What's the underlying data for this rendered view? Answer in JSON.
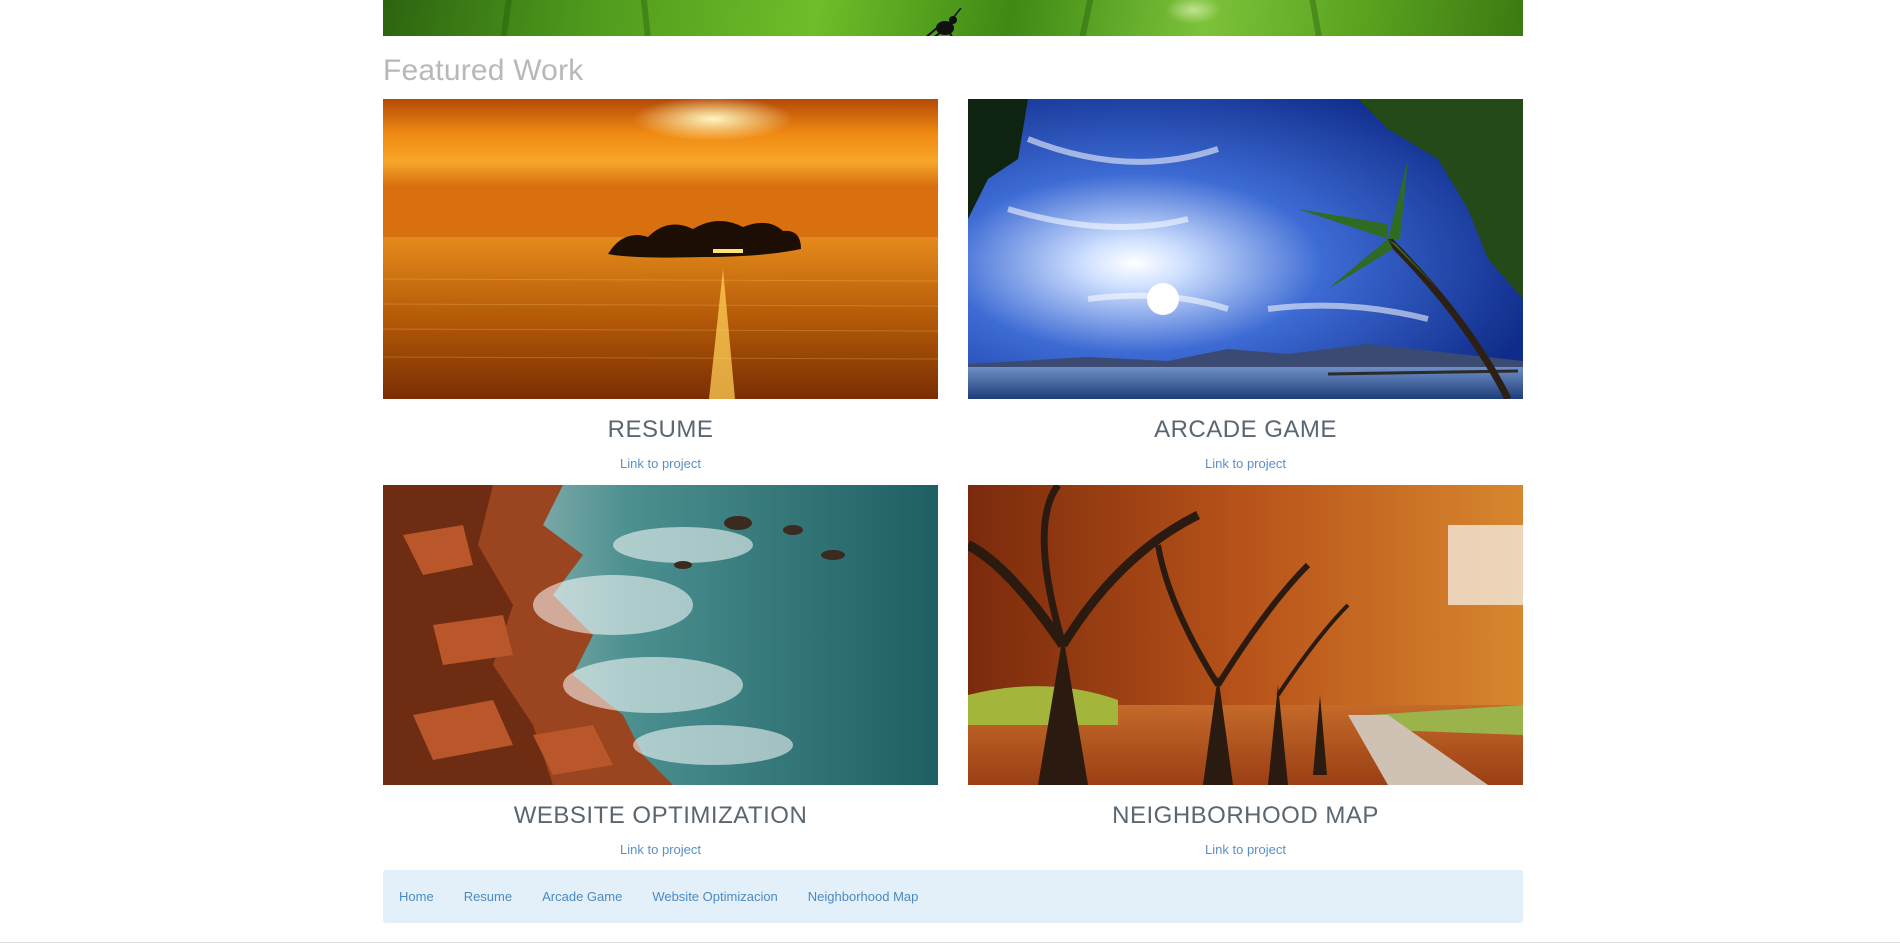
{
  "section": {
    "title": "Featured Work"
  },
  "projects": [
    {
      "name": "RESUME",
      "link_label": "Link to project",
      "image": "sunset-island-photo"
    },
    {
      "name": "ARCADE GAME",
      "link_label": "Link to project",
      "image": "palm-beach-sky-photo"
    },
    {
      "name": "WEBSITE OPTIMIZATION",
      "link_label": "Link to project",
      "image": "rocky-coast-sea-photo"
    },
    {
      "name": "NEIGHBORHOOD MAP",
      "link_label": "Link to project",
      "image": "autumn-tree-avenue-photo"
    }
  ],
  "nav": {
    "items": [
      "Home",
      "Resume",
      "Arcade Game",
      "Website Optimizacion",
      "Neighborhood Map"
    ]
  },
  "colors": {
    "title": "#b8b8b8",
    "project_name": "#5a6670",
    "link": "#5b8fc7",
    "navbar_bg": "#e3eff9",
    "nav_link": "#4a8bc4"
  }
}
